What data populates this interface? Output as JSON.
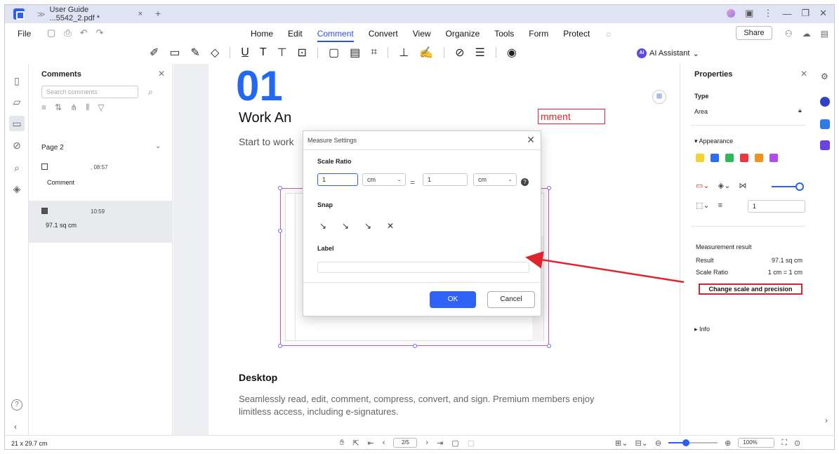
{
  "titlebar": {
    "tab_title": "User Guide ...5542_2.pdf *",
    "tab_close": "×",
    "tab_add": "+",
    "window_controls": [
      "⋮",
      "—",
      "❐",
      "✕"
    ]
  },
  "menubar": {
    "file": "File",
    "menus": [
      "Home",
      "Edit",
      "Comment",
      "Convert",
      "View",
      "Organize",
      "Tools",
      "Form",
      "Protect"
    ],
    "active_menu": "Comment",
    "share": "Share"
  },
  "ribbon": {
    "ai_assistant": "AI Assistant",
    "ai_badge": "AI"
  },
  "comments_panel": {
    "title": "Comments",
    "search_placeholder": "Search comments",
    "page_group": "Page 2",
    "items": [
      {
        "time": ", 08:57",
        "text": "Comment"
      },
      {
        "time": "10:59",
        "text": "97.1 sq cm"
      }
    ]
  },
  "document": {
    "number": "01",
    "heading": "Work An",
    "subtitle": "Start to work",
    "red_box_text": "mment",
    "desktop_heading": "Desktop",
    "desktop_text": "Seamlessly read, edit, comment, compress, convert, and sign. Premium members enjoy limitless access, including e-signatures."
  },
  "dialog": {
    "title": "Measure Settings",
    "scale_ratio_label": "Scale Ratio",
    "left_value": "1",
    "left_unit": "cm",
    "equals": "=",
    "right_value": "1",
    "right_unit": "cm",
    "snap_label": "Snap",
    "label_label": "Label",
    "label_value": "",
    "ok": "OK",
    "cancel": "Cancel"
  },
  "properties": {
    "title": "Properties",
    "type_label": "Type",
    "type_value": "Area",
    "appearance": "Appearance",
    "swatch_colors": [
      "#f5d22c",
      "#2f6cf4",
      "#2fb85a",
      "#e9363f",
      "#f5901e",
      "#b24af2"
    ],
    "line_width": "1",
    "measurement_title": "Measurement result",
    "result_label": "Result",
    "result_value": "97.1 sq cm",
    "scale_label": "Scale Ratio",
    "scale_value": "1 cm = 1 cm",
    "change_button": "Change scale and precision",
    "info": "Info"
  },
  "statusbar": {
    "page_size": "21 x 29.7 cm",
    "page_indicator": "2/5",
    "zoom": "100%",
    "zoom_level": 0.35
  },
  "colors": {
    "accent": "#2c5ff5",
    "annotation_red": "#e0242d",
    "number_blue": "#2268f5"
  }
}
